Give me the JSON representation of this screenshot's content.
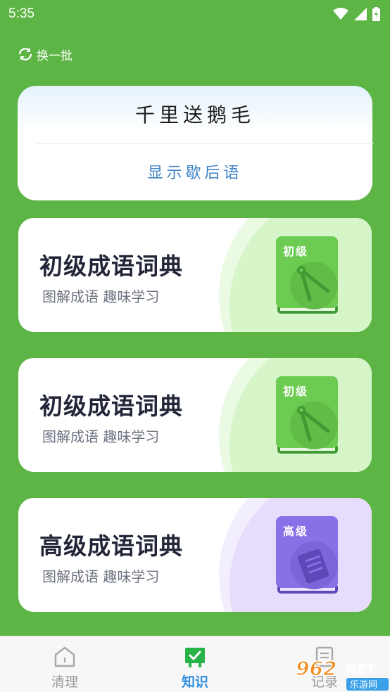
{
  "status_bar": {
    "time": "5:35",
    "icons": [
      "wifi-icon",
      "signal-icon",
      "battery-icon"
    ]
  },
  "refresh": {
    "label": "换一批",
    "icon": "refresh-icon"
  },
  "riddle": {
    "question": "千里送鹅毛",
    "reveal_label": "显示歇后语"
  },
  "cards": [
    {
      "title": "初级成语词典",
      "subtitle": "图解成语 趣味学习",
      "book_label": "初级",
      "accent": "#6ccc52",
      "icon": "compass-icon"
    },
    {
      "title": "初级成语词典",
      "subtitle": "图解成语 趣味学习",
      "book_label": "初级",
      "accent": "#6ccc52",
      "icon": "compass-icon"
    },
    {
      "title": "高级成语词典",
      "subtitle": "图解成语 趣味学习",
      "book_label": "高级",
      "accent": "#8a70e6",
      "icon": "notebook-icon"
    }
  ],
  "tabbar": {
    "tabs": [
      {
        "label": "清理",
        "icon": "home-icon",
        "active": false
      },
      {
        "label": "知识",
        "icon": "knowledge-icon",
        "active": true
      },
      {
        "label": "记录",
        "icon": "document-icon",
        "active": false
      }
    ]
  },
  "watermark": {
    "text": "962.NET",
    "sub": "乐游网"
  },
  "colors": {
    "background": "#5cb545",
    "active_tab": "#2f8fe0",
    "inactive_tab": "#9a9a9a"
  }
}
